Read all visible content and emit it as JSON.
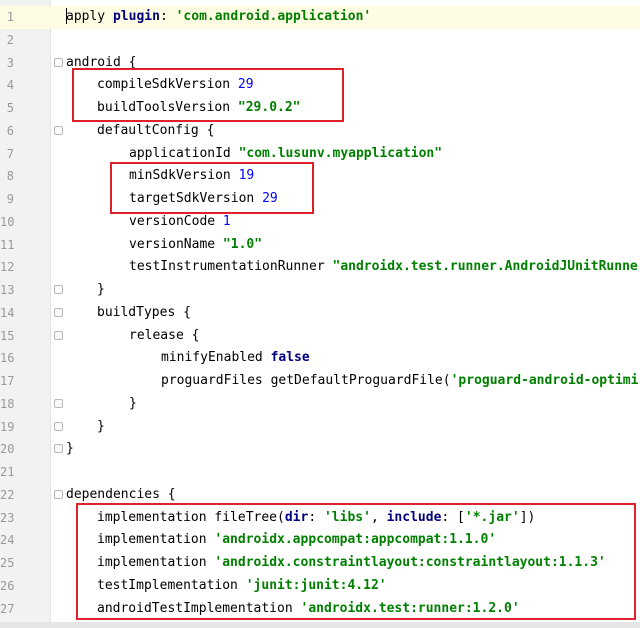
{
  "editor": {
    "lines": [
      {
        "n": "1",
        "tokens": [
          [
            "plain",
            "apply "
          ],
          [
            "kw",
            "plugin"
          ],
          [
            "plain",
            ": "
          ],
          [
            "str",
            "'com.android.application'"
          ]
        ]
      },
      {
        "n": "2",
        "tokens": []
      },
      {
        "n": "3",
        "tokens": [
          [
            "plain",
            "android {"
          ]
        ]
      },
      {
        "n": "4",
        "tokens": [
          [
            "plain",
            "compileSdkVersion "
          ],
          [
            "num",
            "29"
          ]
        ]
      },
      {
        "n": "5",
        "tokens": [
          [
            "plain",
            "buildToolsVersion "
          ],
          [
            "str",
            "\"29.0.2\""
          ]
        ]
      },
      {
        "n": "6",
        "tokens": [
          [
            "plain",
            "defaultConfig {"
          ]
        ]
      },
      {
        "n": "7",
        "tokens": [
          [
            "plain",
            "applicationId "
          ],
          [
            "str",
            "\"com.lusunv.myapplication\""
          ]
        ]
      },
      {
        "n": "8",
        "tokens": [
          [
            "plain",
            "minSdkVersion "
          ],
          [
            "num",
            "19"
          ]
        ]
      },
      {
        "n": "9",
        "tokens": [
          [
            "plain",
            "targetSdkVersion "
          ],
          [
            "num",
            "29"
          ]
        ]
      },
      {
        "n": "10",
        "tokens": [
          [
            "plain",
            "versionCode "
          ],
          [
            "num",
            "1"
          ]
        ]
      },
      {
        "n": "11",
        "tokens": [
          [
            "plain",
            "versionName "
          ],
          [
            "str",
            "\"1.0\""
          ]
        ]
      },
      {
        "n": "12",
        "tokens": [
          [
            "plain",
            "testInstrumentationRunner "
          ],
          [
            "str",
            "\"androidx.test.runner.AndroidJUnitRunne"
          ]
        ]
      },
      {
        "n": "13",
        "tokens": [
          [
            "plain",
            "}"
          ]
        ]
      },
      {
        "n": "14",
        "tokens": [
          [
            "plain",
            "buildTypes {"
          ]
        ]
      },
      {
        "n": "15",
        "tokens": [
          [
            "plain",
            "release {"
          ]
        ]
      },
      {
        "n": "16",
        "tokens": [
          [
            "plain",
            "minifyEnabled "
          ],
          [
            "kw",
            "false"
          ]
        ]
      },
      {
        "n": "17",
        "tokens": [
          [
            "plain",
            "proguardFiles getDefaultProguardFile("
          ],
          [
            "str",
            "'proguard-android-optimi"
          ]
        ]
      },
      {
        "n": "18",
        "tokens": [
          [
            "plain",
            "}"
          ]
        ]
      },
      {
        "n": "19",
        "tokens": [
          [
            "plain",
            "}"
          ]
        ]
      },
      {
        "n": "20",
        "tokens": [
          [
            "plain",
            "}"
          ]
        ]
      },
      {
        "n": "21",
        "tokens": []
      },
      {
        "n": "22",
        "tokens": [
          [
            "plain",
            "dependencies {"
          ]
        ]
      },
      {
        "n": "23",
        "tokens": [
          [
            "plain",
            "implementation fileTree("
          ],
          [
            "kw",
            "dir"
          ],
          [
            "plain",
            ": "
          ],
          [
            "str",
            "'libs'"
          ],
          [
            "plain",
            ", "
          ],
          [
            "kw",
            "include"
          ],
          [
            "plain",
            ": ["
          ],
          [
            "str",
            "'*.jar'"
          ],
          [
            "plain",
            "])"
          ]
        ]
      },
      {
        "n": "24",
        "tokens": [
          [
            "plain",
            "implementation "
          ],
          [
            "str",
            "'androidx.appcompat:appcompat:1.1.0'"
          ]
        ]
      },
      {
        "n": "25",
        "tokens": [
          [
            "plain",
            "implementation "
          ],
          [
            "str",
            "'androidx.constraintlayout:constraintlayout:1.1.3'"
          ]
        ]
      },
      {
        "n": "26",
        "tokens": [
          [
            "plain",
            "testImplementation "
          ],
          [
            "str",
            "'junit:junit:4.12'"
          ]
        ]
      },
      {
        "n": "27",
        "tokens": [
          [
            "plain",
            "androidTestImplementation "
          ],
          [
            "str",
            "'androidx.test:runner:1.2.0'"
          ]
        ]
      }
    ]
  },
  "colors": {
    "keyword": "#000080",
    "string": "#008000",
    "number": "#0000ff",
    "highlight_box": "#e0202a",
    "current_line": "#fffce4",
    "gutter": "#f2f2f2"
  }
}
